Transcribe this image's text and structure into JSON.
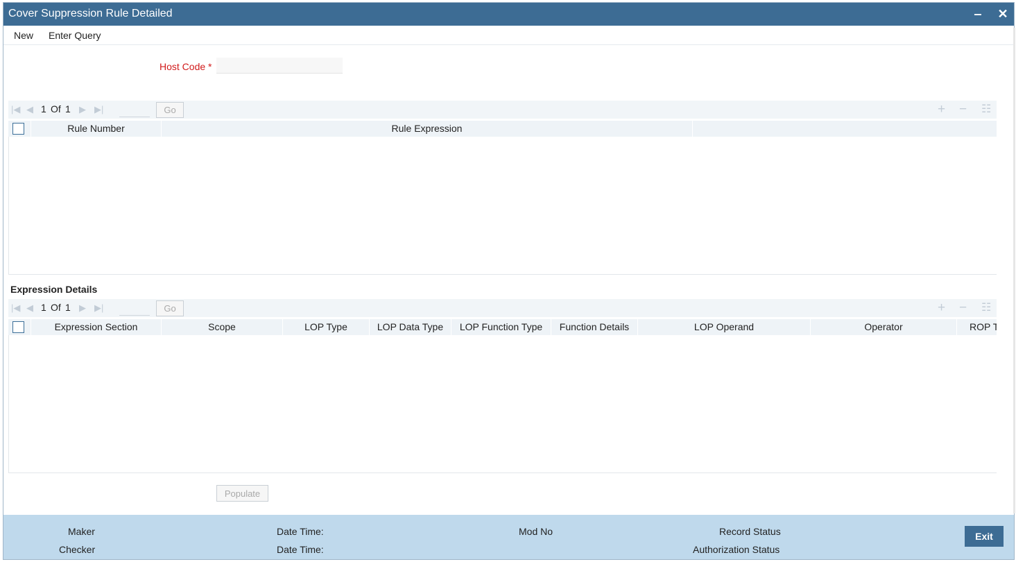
{
  "window": {
    "title": "Cover Suppression Rule Detailed",
    "minimize_glyph": "‒",
    "close_glyph": "✕"
  },
  "menu": {
    "new_label": "New",
    "enter_query_label": "Enter Query"
  },
  "form": {
    "host_code_label": "Host Code",
    "required_mark": "*",
    "host_code_value": ""
  },
  "rules_grid": {
    "pager": {
      "current": "1",
      "of_label": "Of",
      "total": "1",
      "go_label": "Go"
    },
    "columns": [
      "Rule Number",
      "Rule Expression",
      ""
    ]
  },
  "expression_details": {
    "title": "Expression Details",
    "pager": {
      "current": "1",
      "of_label": "Of",
      "total": "1",
      "go_label": "Go"
    },
    "columns": [
      "Expression Section",
      "Scope",
      "LOP Type",
      "LOP Data Type",
      "LOP Function Type",
      "Function Details",
      "LOP Operand",
      "Operator",
      "ROP Type"
    ]
  },
  "populate_label": "Populate",
  "footer": {
    "maker_label": "Maker",
    "checker_label": "Checker",
    "datetime_label_1": "Date Time:",
    "datetime_label_2": "Date Time:",
    "mod_no_label": "Mod No",
    "record_status_label": "Record Status",
    "authorization_status_label": "Authorization Status",
    "exit_label": "Exit"
  },
  "colors": {
    "titlebar": "#3d6c94",
    "footer": "#bfd9ec",
    "required": "#d11a1a"
  }
}
